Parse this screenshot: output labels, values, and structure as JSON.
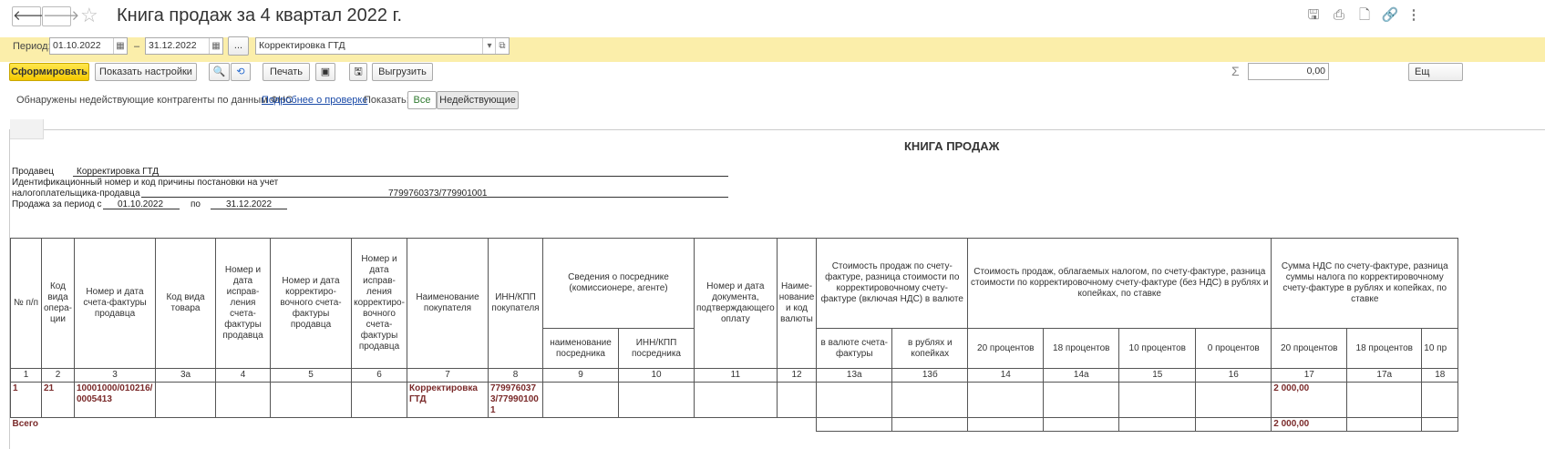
{
  "window": {
    "title": "Книга продаж за 4 квартал 2022 г."
  },
  "period": {
    "label": "Период:",
    "from": "01.10.2022",
    "dash": "–",
    "to": "31.12.2022",
    "more_btn": "...",
    "org": "Корректировка ГТД"
  },
  "toolbar": {
    "generate": "Сформировать",
    "show_settings": "Показать настройки",
    "print": "Печать",
    "export": "Выгрузить",
    "sum_value": "0,00",
    "more": "Ещ"
  },
  "fns": {
    "text": "Обнаружены недействующие контрагенты по данным ФНС",
    "link": "Подробнее о проверке",
    "show_label": "Показать:",
    "all": "Все",
    "inactive": "Недействующие"
  },
  "report": {
    "title": "КНИГА ПРОДАЖ",
    "seller_label": "Продавец",
    "seller_value": "Корректировка ГТД",
    "inn_label_1": "Идентификационный номер и код причины постановки на учет",
    "inn_label_2": "налогоплательщика-продавца",
    "inn_value": "7799760373/779901001",
    "period_label": "Продажа за период с",
    "period_from": "01.10.2022",
    "period_to_label": "по",
    "period_to": "31.12.2022"
  },
  "table": {
    "headers": {
      "c1": "№ п/п",
      "c2": "Код вида опера-ции",
      "c3": "Номер и дата счета-фактуры продавца",
      "c3a": "Код вида товара",
      "c4": "Номер и дата исправ-ления счета-фактуры продавца",
      "c5": "Номер и дата корректиро-вочного счета-фактуры продавца",
      "c6": "Номер и дата исправ-ления корректиро-вочного счета-фактуры продавца",
      "c7": "Наименование покупателя",
      "c8": "ИНН/КПП покупателя",
      "c9_10": "Сведения о посреднике (комиссионере, агенте)",
      "c9": "наименование посредника",
      "c10": "ИНН/КПП посредника",
      "c11": "Номер и дата документа, подтверждающего оплату",
      "c12": "Наиме-нование и код валюты",
      "c13": "Стоимость продаж по счету-фактуре, разница стоимости по корректировочному счету-фактуре (включая НДС) в валюте",
      "c13a": "в валюте счета-фактуры",
      "c13b": "в рублях и копейках",
      "c14_16": "Стоимость продаж, облагаемых налогом, по счету-фактуре, разница стоимости по корректировочному счету-фактуре (без НДС) в рублях и копейках, по ставке",
      "c14": "20 процентов",
      "c14a": "18 процентов",
      "c15": "10 процентов",
      "c16": "0 процентов",
      "c17_": "Сумма НДС по счету-фактуре, разница суммы налога по корректировочному счету-фактуре в рублях и копейках, по ставке",
      "c17": "20 процентов",
      "c17a": "18 процентов",
      "c18": "10 пр"
    },
    "numbers": [
      "1",
      "2",
      "3",
      "3а",
      "4",
      "5",
      "6",
      "7",
      "8",
      "9",
      "10",
      "11",
      "12",
      "13а",
      "13б",
      "14",
      "14а",
      "15",
      "16",
      "17",
      "17а",
      "18"
    ],
    "row": {
      "n": "1",
      "op": "21",
      "invoice": "10001000/010216/0005413",
      "buyer": "Корректировка ГТД",
      "inn": "7799760373/779901001",
      "vat20": "2 000,00"
    },
    "total_label": "Всего",
    "total_vat20": "2 000,00"
  }
}
